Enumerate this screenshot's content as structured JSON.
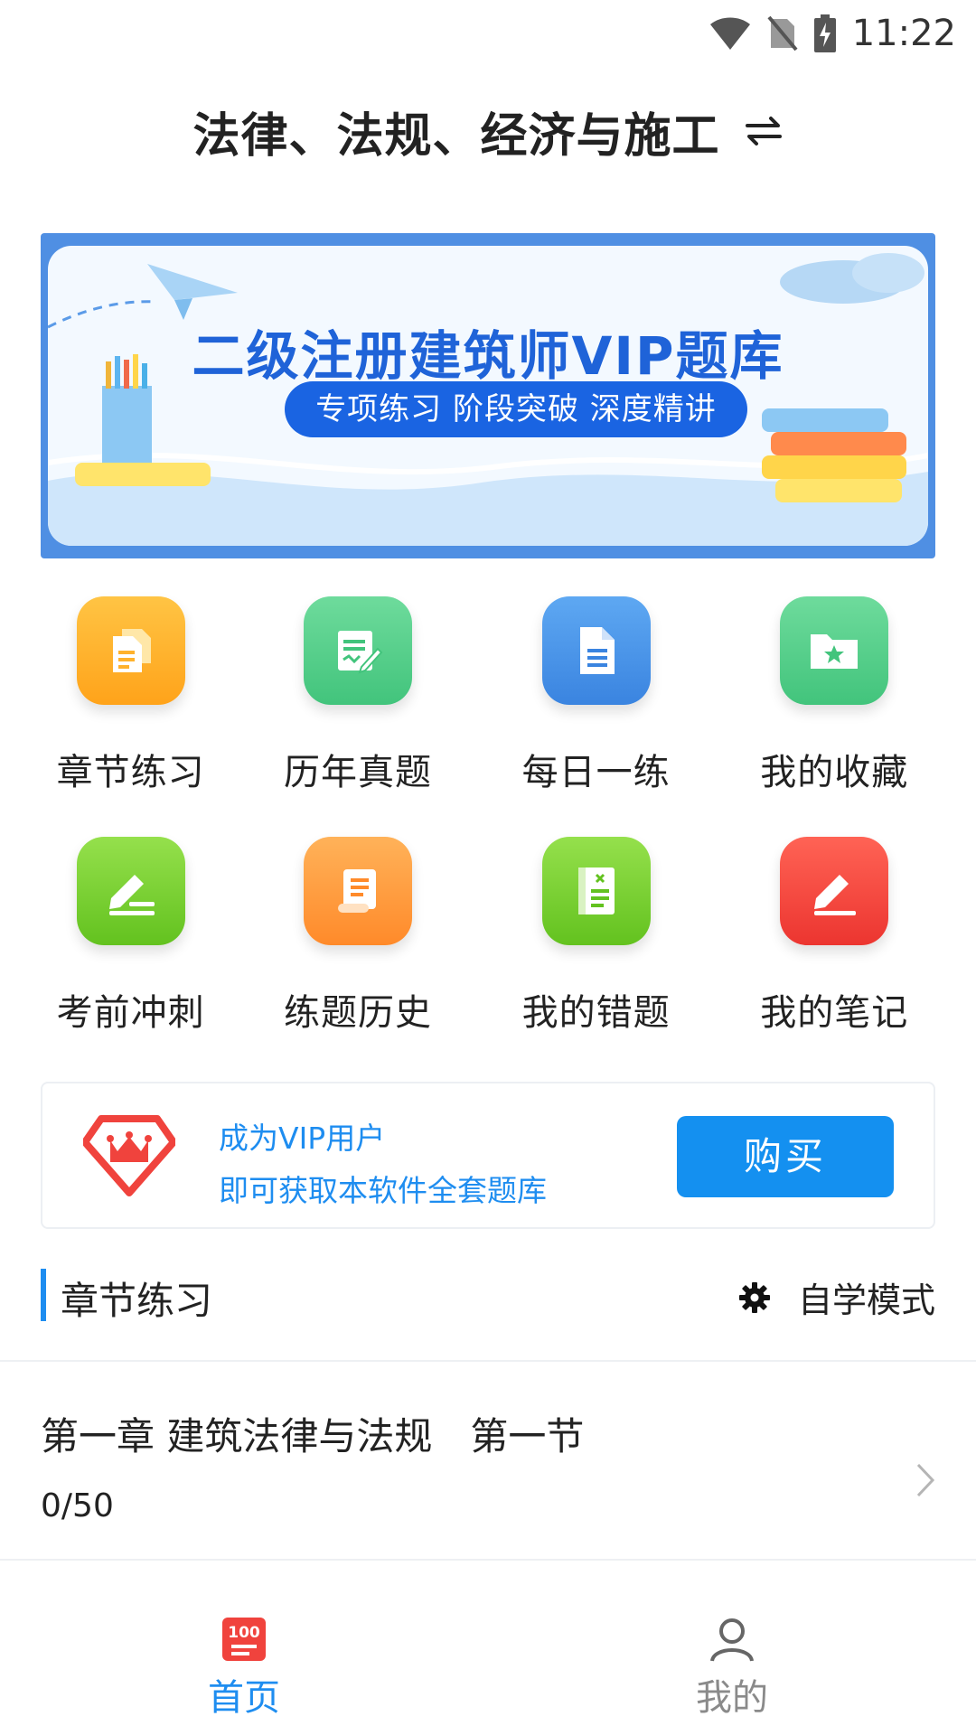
{
  "status_bar": {
    "time": "11:22"
  },
  "header": {
    "title": "法律、法规、经济与施工"
  },
  "banner": {
    "title": "二级注册建筑师VIP题库",
    "subtitle": "专项练习 阶段突破 深度精讲",
    "colors": {
      "frame": "#4f8fe3",
      "title": "#1f63d8",
      "pill": "#1a64e2"
    }
  },
  "grid": [
    {
      "label": "章节练习",
      "icon": "documents-icon",
      "color": "#ffb22c"
    },
    {
      "label": "历年真题",
      "icon": "edit-document-icon",
      "color": "#4fcf87"
    },
    {
      "label": "每日一练",
      "icon": "file-icon",
      "color": "#3f8fe8"
    },
    {
      "label": "我的收藏",
      "icon": "star-folder-icon",
      "color": "#4fcf87"
    },
    {
      "label": "考前冲刺",
      "icon": "pencil-icon",
      "color": "#7fd13a"
    },
    {
      "label": "练题历史",
      "icon": "scroll-icon",
      "color": "#ff9a3c"
    },
    {
      "label": "我的错题",
      "icon": "wrong-book-icon",
      "color": "#7fd13a"
    },
    {
      "label": "我的笔记",
      "icon": "note-pencil-icon",
      "color": "#f0433d"
    }
  ],
  "vip": {
    "line1": "成为VIP用户",
    "line2": "即可获取本软件全套题库",
    "buy_label": "购买",
    "icon": "crown-diamond-icon",
    "accent": "#1e8df0"
  },
  "section": {
    "title": "章节练习",
    "mode_icon": "gear-icon",
    "mode_label": "自学模式"
  },
  "chapters": [
    {
      "title": "第一章 建筑法律与法规　第一节",
      "progress": "0/50"
    }
  ],
  "tabbar": {
    "tabs": [
      {
        "label": "首页",
        "icon": "home-100-icon",
        "active": true
      },
      {
        "label": "我的",
        "icon": "person-icon",
        "active": false
      }
    ]
  }
}
